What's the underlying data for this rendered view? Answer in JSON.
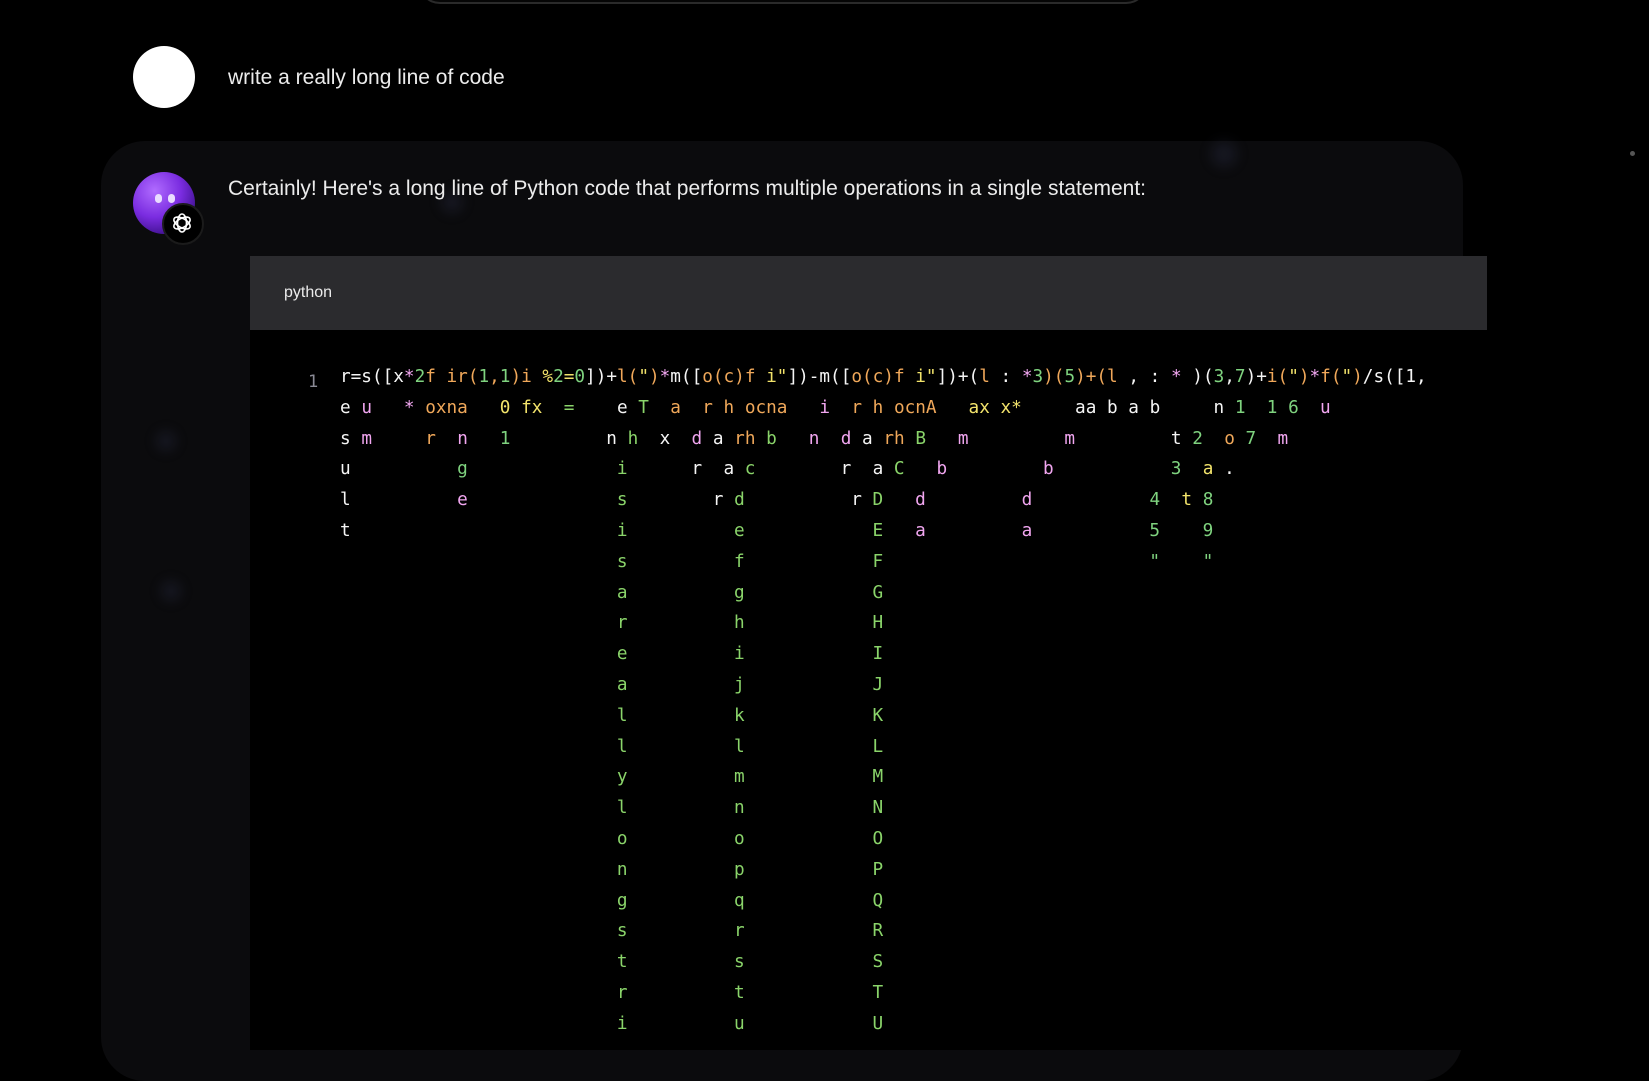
{
  "user": {
    "message": "write a really long line of code"
  },
  "assistant": {
    "message": "Certainly! Here's a long line of Python code that performs multiple operations in a single statement:",
    "avatar_icon": "purple-blob-icon",
    "badge_icon": "openai-logo-icon"
  },
  "code_block": {
    "language": "python",
    "line_number": "1"
  },
  "colors": {
    "background": "#000000",
    "card": "#0b0b0d",
    "code_header": "#2b2b2e",
    "text": "#ececec"
  }
}
